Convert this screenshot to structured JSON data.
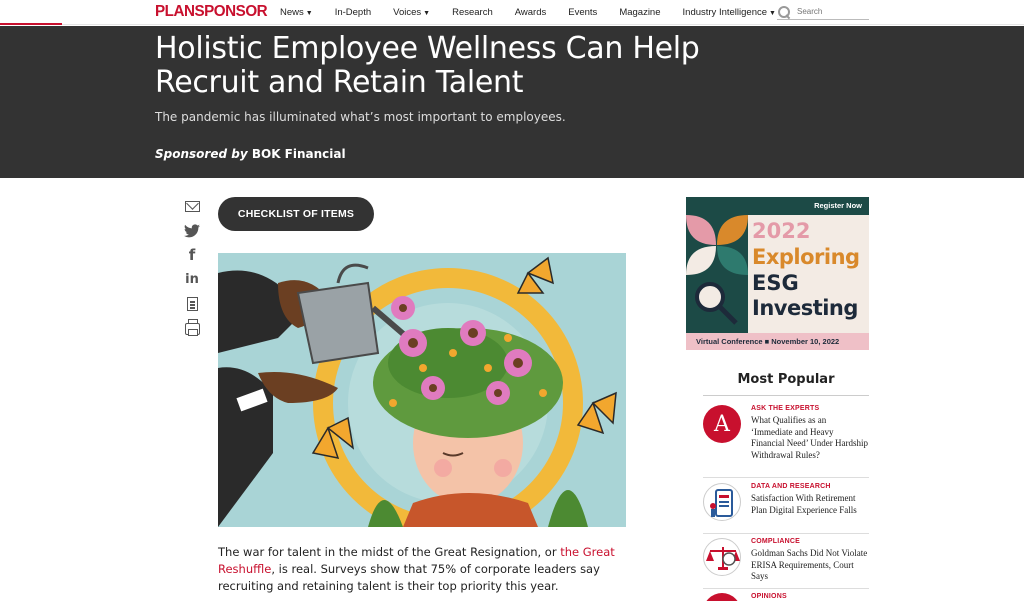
{
  "brand": {
    "logo": "PLANSPONSOR",
    "accent": "#c8102e"
  },
  "nav": {
    "items": [
      {
        "label": "News",
        "dropdown": true
      },
      {
        "label": "In-Depth",
        "dropdown": false
      },
      {
        "label": "Voices",
        "dropdown": true
      },
      {
        "label": "Research",
        "dropdown": false
      },
      {
        "label": "Awards",
        "dropdown": false
      },
      {
        "label": "Events",
        "dropdown": false
      },
      {
        "label": "Magazine",
        "dropdown": false
      },
      {
        "label": "Industry Intelligence",
        "dropdown": true
      }
    ],
    "search_placeholder": "Search"
  },
  "hero": {
    "title": "Holistic Employee Wellness Can Help Recruit and Retain Talent",
    "dek": "The pandemic has illuminated what’s most important to employees.",
    "sponsor_prefix": "Sponsored by",
    "sponsor_name": "BOK Financial",
    "background": "#333333"
  },
  "share_icons": [
    "mail-icon",
    "twitter-icon",
    "facebook-icon",
    "linkedin-icon",
    "document-icon",
    "print-icon"
  ],
  "article": {
    "checklist_label": "CHECKLIST OF ITEMS",
    "illustration_alt": "illustration",
    "para_before_link": "The war for talent in the midst of the Great Resignation, or ",
    "link_text": "the Great Reshuffle",
    "para_after_link": ", is real. Surveys show that 75% of corporate leaders say recruiting and retaining talent is their top priority this year."
  },
  "ad": {
    "register": "Register Now",
    "year": "2022",
    "line2": "Exploring",
    "line3": "ESG",
    "line4": "Investing",
    "footer": "Virtual Conference ■ November 10, 2022"
  },
  "most_popular": {
    "title": "Most Popular",
    "items": [
      {
        "category": "ASK THE EXPERTS",
        "headline": "What Qualifies as an ‘Immediate and Heavy Financial Need’ Under Hardship Withdrawal Rules?",
        "thumb_letter": "A"
      },
      {
        "category": "DATA AND RESEARCH",
        "headline": "Satisfaction With Retirement Plan Digital Experience Falls"
      },
      {
        "category": "COMPLIANCE",
        "headline": "Goldman Sachs Did Not Violate ERISA Requirements, Court Says"
      },
      {
        "category": "OPINIONS",
        "headline": ""
      }
    ]
  }
}
